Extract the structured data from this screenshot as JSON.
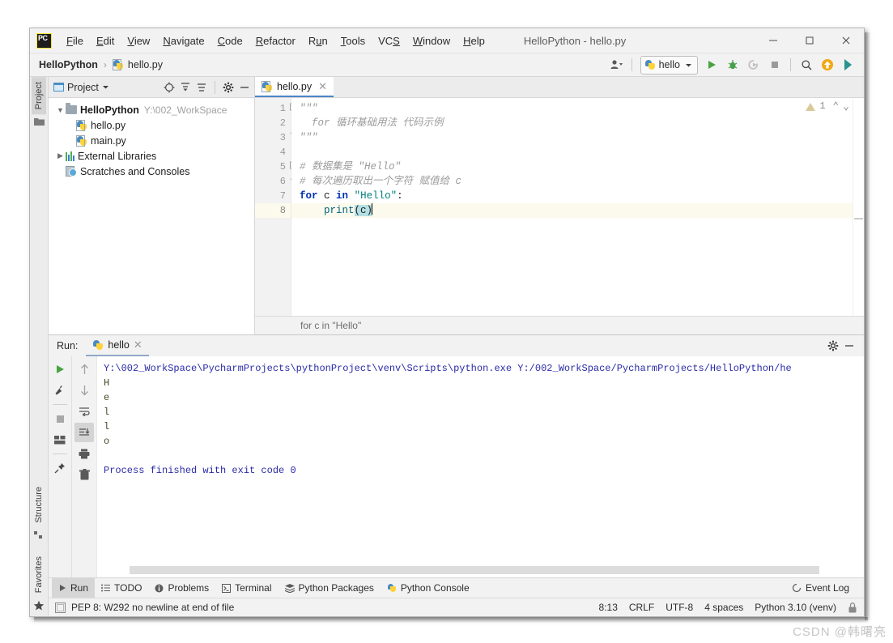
{
  "window": {
    "title": "HelloPython - hello.py",
    "minimize": "—",
    "maximize": "□",
    "close": "✕"
  },
  "menu": {
    "items": [
      {
        "label": "File",
        "mnemonic": "F",
        "rest": "ile"
      },
      {
        "label": "Edit",
        "mnemonic": "E",
        "rest": "dit"
      },
      {
        "label": "View",
        "mnemonic": "V",
        "rest": "iew"
      },
      {
        "label": "Navigate",
        "mnemonic": "N",
        "rest": "avigate"
      },
      {
        "label": "Code",
        "mnemonic": "C",
        "rest": "ode"
      },
      {
        "label": "Refactor",
        "mnemonic": "R",
        "rest": "efactor"
      },
      {
        "label": "Run",
        "mnemonic": "R",
        "rest": "un"
      },
      {
        "label": "Tools",
        "mnemonic": "T",
        "rest": "ools"
      },
      {
        "label": "VCS",
        "mnemonic": "S",
        "rest": "VCS"
      },
      {
        "label": "Window",
        "mnemonic": "W",
        "rest": "indow"
      },
      {
        "label": "Help",
        "mnemonic": "H",
        "rest": "elp"
      }
    ]
  },
  "navbar": {
    "project_name": "HelloPython",
    "separator": "›",
    "file_name": "hello.py",
    "run_config": "hello",
    "dropdown_caret": "▼"
  },
  "project_panel": {
    "title": "Project",
    "caret": "▼",
    "tree": [
      {
        "arrow": "⌄",
        "label": "HelloPython",
        "path": "Y:\\002_WorkSpace",
        "icon": "folder-icon",
        "bold": true,
        "indent": 0
      },
      {
        "arrow": "",
        "label": "hello.py",
        "path": "",
        "icon": "python-file-icon",
        "bold": false,
        "indent": 1
      },
      {
        "arrow": "",
        "label": "main.py",
        "path": "",
        "icon": "python-file-icon",
        "bold": false,
        "indent": 1
      },
      {
        "arrow": "›",
        "label": "External Libraries",
        "path": "",
        "icon": "library-icon",
        "bold": false,
        "indent": 0
      },
      {
        "arrow": "",
        "label": "Scratches and Consoles",
        "path": "",
        "icon": "scratches-icon",
        "bold": false,
        "indent": 0
      }
    ]
  },
  "left_strip": {
    "tabs": [
      "Project",
      "Structure",
      "Favorites"
    ]
  },
  "editor": {
    "tab_label": "hello.py",
    "tab_close": "✕",
    "inspection_count": "1",
    "chevron_up": "⌃",
    "chevron_down": "⌄",
    "breadcrumb": "for c in \"Hello\"",
    "line_numbers": [
      "1",
      "2",
      "3",
      "4",
      "5",
      "6",
      "7",
      "8"
    ],
    "current_line": 8,
    "lines": [
      {
        "n": 1,
        "parts": [
          {
            "t": "\"\"\"",
            "c": "tok-doc"
          }
        ]
      },
      {
        "n": 2,
        "parts": [
          {
            "t": "  for 循环基础用法 代码示例",
            "c": "tok-doc"
          }
        ]
      },
      {
        "n": 3,
        "parts": [
          {
            "t": "\"\"\"",
            "c": "tok-doc"
          }
        ]
      },
      {
        "n": 4,
        "parts": []
      },
      {
        "n": 5,
        "parts": [
          {
            "t": "# 数据集是 \"Hello\"",
            "c": "tok-cmt"
          }
        ]
      },
      {
        "n": 6,
        "parts": [
          {
            "t": "# 每次遍历取出一个字符 赋值给 c",
            "c": "tok-cmt"
          }
        ]
      },
      {
        "n": 7,
        "parts": [
          {
            "t": "for",
            "c": "tok-kw"
          },
          {
            "t": " c ",
            "c": "tok-plain"
          },
          {
            "t": "in",
            "c": "tok-kw"
          },
          {
            "t": " ",
            "c": "tok-plain"
          },
          {
            "t": "\"Hello\"",
            "c": "tok-str"
          },
          {
            "t": ":",
            "c": "tok-plain"
          }
        ]
      },
      {
        "n": 8,
        "parts": [
          {
            "t": "    ",
            "c": "tok-plain"
          },
          {
            "t": "print",
            "c": "tok-fn"
          },
          {
            "t": "(c)",
            "c": "tok-plain"
          }
        ]
      }
    ]
  },
  "run_panel": {
    "label": "Run:",
    "tab_label": "hello",
    "tab_close": "✕",
    "console_lines": [
      {
        "text": "Y:\\002_WorkSpace\\PycharmProjects\\pythonProject\\venv\\Scripts\\python.exe Y:/002_WorkSpace/PycharmProjects/HelloPython/he",
        "kind": "cmd"
      },
      {
        "text": "H",
        "kind": "out"
      },
      {
        "text": "e",
        "kind": "out"
      },
      {
        "text": "l",
        "kind": "out"
      },
      {
        "text": "l",
        "kind": "out"
      },
      {
        "text": "o",
        "kind": "out"
      },
      {
        "text": "",
        "kind": "out"
      },
      {
        "text": "Process finished with exit code 0",
        "kind": "fin"
      }
    ],
    "tools_left": [
      "run-icon",
      "wrench-icon",
      "stop-icon",
      "layout-icon",
      "pin-icon"
    ],
    "tools_right": [
      "scroll-up-icon",
      "scroll-down-icon",
      "soft-wrap-icon",
      "scroll-to-end-icon",
      "print-icon",
      "trash-icon"
    ],
    "settings_icon": "gear-icon",
    "hide_icon": "minimize-icon"
  },
  "bottom_bar": {
    "items": [
      {
        "label": "Run",
        "icon": "play-icon",
        "active": true
      },
      {
        "label": "TODO",
        "icon": "todo-icon",
        "active": false
      },
      {
        "label": "Problems",
        "icon": "problems-icon",
        "active": false
      },
      {
        "label": "Terminal",
        "icon": "terminal-icon",
        "active": false
      },
      {
        "label": "Python Packages",
        "icon": "packages-icon",
        "active": false
      },
      {
        "label": "Python Console",
        "icon": "python-console-icon",
        "active": false
      }
    ],
    "event_log": "Event Log",
    "event_log_icon": "event-log-icon"
  },
  "status_bar": {
    "message": "PEP 8: W292 no newline at end of file",
    "caret_position": "8:13",
    "line_separator": "CRLF",
    "encoding": "UTF-8",
    "indent": "4 spaces",
    "interpreter": "Python 3.10 (venv)",
    "lock_icon": "lock-icon"
  },
  "watermark": "CSDN @韩曙亮",
  "colors": {
    "accent_blue": "#4a86c8",
    "run_green": "#4caf50",
    "keyword_blue": "#0033b3",
    "string_teal": "#008080",
    "comment_gray": "#9b9b9b",
    "selection": "#b4e0e4",
    "chrome": "#f2f2f2"
  }
}
